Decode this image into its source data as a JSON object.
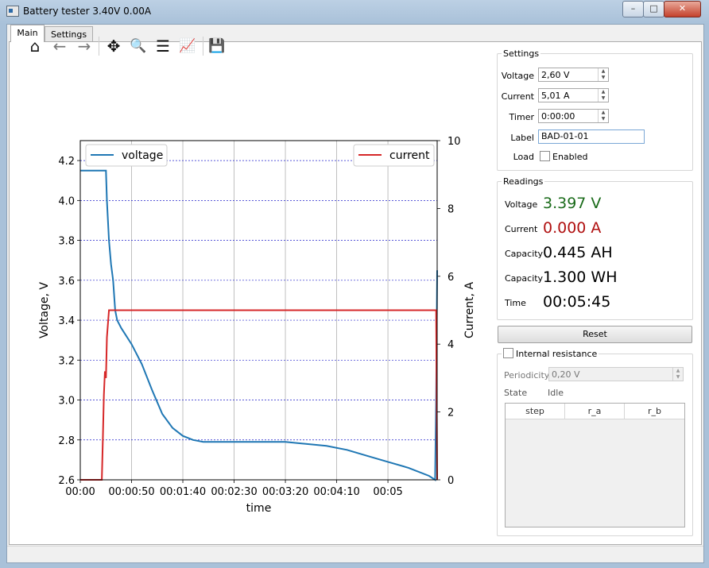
{
  "window": {
    "title": "Battery tester 3.40V 0.00A",
    "minimize": "–",
    "maximize": "□",
    "close": "✕"
  },
  "tabs": [
    {
      "label": "Main"
    },
    {
      "label": "Settings"
    }
  ],
  "toolbar": {
    "icons": [
      "home-icon",
      "back-arrow-icon",
      "forward-arrow-icon",
      "pan-icon",
      "zoom-icon",
      "configure-subplots-icon",
      "edit-axis-icon",
      "save-icon"
    ],
    "glyphs": {
      "home": "⌂",
      "back": "←",
      "forward": "→",
      "pan": "✥",
      "zoom": "🔍",
      "subplots": "☰",
      "axes": "📈",
      "save": "💾"
    }
  },
  "chart_data": {
    "type": "line",
    "xlabel": "time",
    "ylabel_left": "Voltage, V",
    "ylabel_right": "Current, A",
    "ylim_left": [
      2.6,
      4.3
    ],
    "ylim_right": [
      0,
      10
    ],
    "yticks_left": [
      "2.6",
      "2.8",
      "3.0",
      "3.2",
      "3.4",
      "3.6",
      "3.8",
      "4.0",
      "4.2"
    ],
    "yticks_right": [
      "0",
      "2",
      "4",
      "6",
      "8",
      "10"
    ],
    "xticks": [
      "00:00",
      "00:00:50",
      "00:01:40",
      "00:02:30",
      "00:03:20",
      "00:04:10",
      "00:05"
    ],
    "xtick_seconds": [
      0,
      50,
      100,
      150,
      200,
      250,
      300
    ],
    "xlim_seconds": [
      0,
      348
    ],
    "grid": true,
    "legend_left": "top-left",
    "legend_right": "top-right",
    "series": [
      {
        "name": "voltage",
        "color": "#1f77b4",
        "axis": "left",
        "x": [
          0,
          15,
          20,
          25,
          26,
          28,
          30,
          32,
          34,
          36,
          40,
          50,
          60,
          70,
          80,
          90,
          100,
          110,
          120,
          130,
          140,
          150,
          180,
          200,
          220,
          240,
          260,
          280,
          300,
          320,
          340,
          346,
          347,
          348
        ],
        "y": [
          4.15,
          4.15,
          4.15,
          4.15,
          4.0,
          3.8,
          3.68,
          3.6,
          3.45,
          3.4,
          3.36,
          3.28,
          3.18,
          3.05,
          2.93,
          2.86,
          2.82,
          2.8,
          2.79,
          2.79,
          2.79,
          2.79,
          2.79,
          2.79,
          2.78,
          2.77,
          2.75,
          2.72,
          2.69,
          2.66,
          2.62,
          2.6,
          3.0,
          3.65
        ]
      },
      {
        "name": "current",
        "color": "#d62728",
        "axis": "right",
        "x": [
          0,
          21,
          22,
          23,
          24,
          25,
          26,
          27,
          28,
          347,
          348
        ],
        "y": [
          0,
          0,
          1.2,
          2.5,
          3.2,
          3.0,
          4.2,
          4.6,
          5.0,
          5.0,
          0
        ]
      }
    ]
  },
  "settings": {
    "title": "Settings",
    "voltage": {
      "label": "Voltage",
      "value": "2,60 V"
    },
    "current": {
      "label": "Current",
      "value": "5,01 A"
    },
    "timer": {
      "label": "Timer",
      "value": "0:00:00"
    },
    "label_field": {
      "label": "Label",
      "value": "BAD-01-01"
    },
    "load": {
      "label": "Load",
      "checkbox_label": "Enabled",
      "checked": false
    }
  },
  "readings": {
    "title": "Readings",
    "voltage": {
      "label": "Voltage",
      "value": "3.397 V",
      "color": "#1a6b1a"
    },
    "current": {
      "label": "Current",
      "value": "0.000 A",
      "color": "#b01010"
    },
    "capacity_ah": {
      "label": "Capacity",
      "value": "0.445 AH"
    },
    "capacity_wh": {
      "label": "Capacity",
      "value": "1.300 WH"
    },
    "time": {
      "label": "Time",
      "value": "00:05:45"
    }
  },
  "reset_label": "Reset",
  "internal_resistance": {
    "checkbox_label": "Internal resistance",
    "checked": false,
    "periodicity": {
      "label": "Periodicity",
      "value": "0,20 V"
    },
    "state": {
      "label": "State",
      "value": "Idle"
    },
    "columns": [
      "step",
      "r_a",
      "r_b"
    ]
  }
}
